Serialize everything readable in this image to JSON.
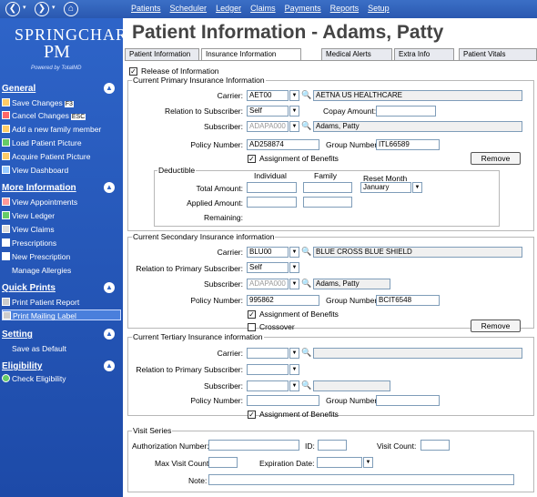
{
  "window": {
    "title": "Patient Information - Adams, Patty"
  },
  "nav": {
    "back": "❮",
    "forward": "❯",
    "home": "⌂",
    "sep": "▾"
  },
  "menu": [
    "Patients",
    "Scheduler",
    "Ledger",
    "Claims",
    "Payments",
    "Reports",
    "Setup"
  ],
  "logo": {
    "line1": "SPRINGCHARTS",
    "line2": "PM",
    "powered": "Powered by TotalMD"
  },
  "sidebar": {
    "general": {
      "title": "General",
      "items": [
        {
          "label": "Save Changes",
          "key": "F3"
        },
        {
          "label": "Cancel Changes",
          "key": "ESC"
        },
        {
          "label": "Add a new family member"
        },
        {
          "label": "Load Patient Picture"
        },
        {
          "label": "Acquire Patient Picture"
        },
        {
          "label": "View Dashboard"
        }
      ]
    },
    "more": {
      "title": "More Information",
      "items": [
        {
          "label": "View Appointments"
        },
        {
          "label": "View Ledger"
        },
        {
          "label": "View Claims"
        },
        {
          "label": "Prescriptions"
        },
        {
          "label": "New Prescription"
        },
        {
          "label": "Manage Allergies"
        }
      ]
    },
    "quick": {
      "title": "Quick Prints",
      "items": [
        {
          "label": "Print Patient Report"
        },
        {
          "label": "Print Mailing Label"
        }
      ]
    },
    "setting": {
      "title": "Setting",
      "items": [
        {
          "label": "Save as Default"
        }
      ]
    },
    "eligibility": {
      "title": "Eligibility",
      "items": [
        {
          "label": "Check Eligibility"
        }
      ]
    },
    "collapse": "▲"
  },
  "tabs": [
    "Patient Information",
    "Insurance Information",
    "Medical Alerts",
    "Extra Info",
    "Patient Vitals"
  ],
  "release": {
    "label": "Release of Information",
    "checked": "✓"
  },
  "primary": {
    "legend": "Current Primary Insurance Information",
    "carrier_label": "Carrier:",
    "carrier_code": "AET00",
    "carrier_name": "AETNA US HEALTHCARE",
    "relation_label": "Relation to Subscriber:",
    "relation": "Self",
    "copay_label": "Copay Amount:",
    "copay": "",
    "subscriber_label": "Subscriber:",
    "subscriber_code": "ADAPA000",
    "subscriber_name": "Adams, Patty",
    "policy_label": "Policy Number:",
    "policy": "AD258874",
    "group_label": "Group Number:",
    "group": "ITL66589",
    "assign_label": "Assignment of Benefits",
    "assign_checked": "✓",
    "remove": "Remove"
  },
  "deductible": {
    "legend": "Deductible",
    "individual": "Individual",
    "family": "Family",
    "reset_label": "Reset Month",
    "reset_value": "January",
    "total_label": "Total Amount:",
    "applied_label": "Applied Amount:",
    "remaining_label": "Remaining:"
  },
  "secondary": {
    "legend": "Current Secondary Insurance information",
    "carrier_label": "Carrier:",
    "carrier_code": "BLU00",
    "carrier_name": "BLUE CROSS  BLUE SHIELD",
    "relation_label": "Relation to Primary Subscriber:",
    "relation": "Self",
    "subscriber_label": "Subscriber:",
    "subscriber_code": "ADAPA000",
    "subscriber_name": "Adams, Patty",
    "policy_label": "Policy Number:",
    "policy": "995862",
    "group_label": "Group Number:",
    "group": "BCIT6548",
    "assign_label": "Assignment of Benefits",
    "assign_checked": "✓",
    "crossover_label": "Crossover",
    "remove": "Remove"
  },
  "tertiary": {
    "legend": "Current Tertiary Insurance information",
    "carrier_label": "Carrier:",
    "relation_label": "Relation to Primary Subscriber:",
    "subscriber_label": "Subscriber:",
    "policy_label": "Policy Number:",
    "group_label": "Group Number:",
    "assign_label": "Assignment of Benefits",
    "assign_checked": "✓"
  },
  "visit": {
    "legend": "Visit Series",
    "auth_label": "Authorization Number:",
    "id_label": "ID:",
    "count_label": "Visit Count:",
    "max_label": "Max Visit Count:",
    "exp_label": "Expiration Date:",
    "note_label": "Note:"
  },
  "icons": {
    "dropdown": "▼",
    "lookup": "🔍"
  }
}
